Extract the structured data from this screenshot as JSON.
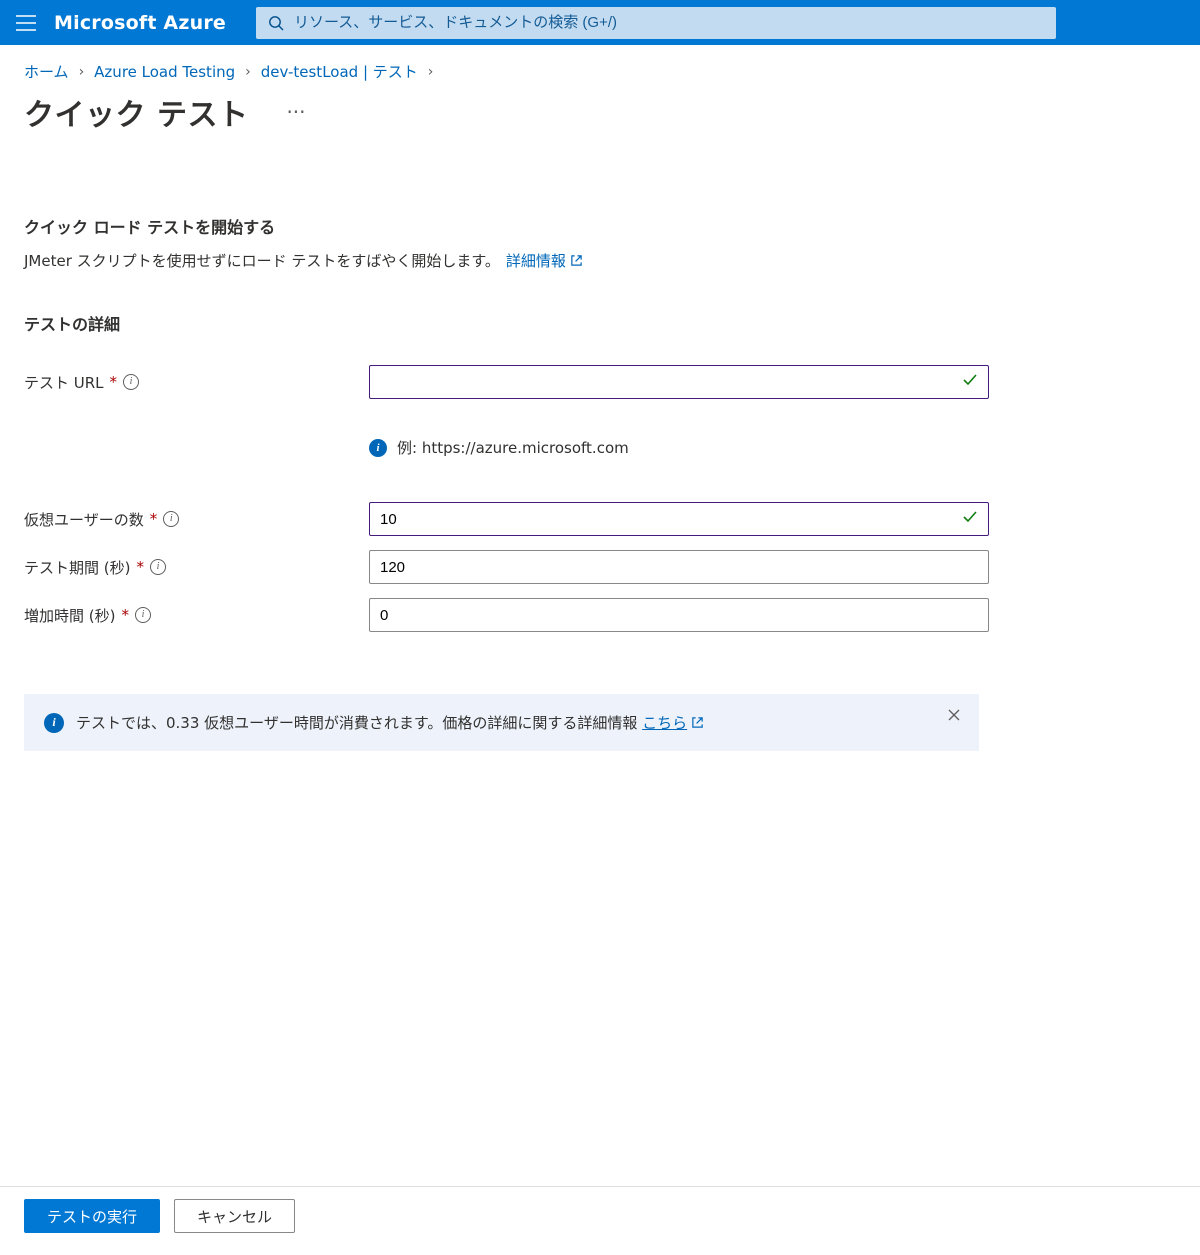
{
  "header": {
    "brand": "Microsoft Azure",
    "search_placeholder": "リソース、サービス、ドキュメントの検索 (G+/)"
  },
  "breadcrumbs": {
    "items": [
      "ホーム",
      "Azure Load Testing",
      "dev-testLoad | テスト"
    ]
  },
  "page": {
    "title": "クイック テスト"
  },
  "intro": {
    "heading": "クイック ロード テストを開始する",
    "text": "JMeter スクリプトを使用せずにロード テストをすばやく開始します。",
    "link_label": "詳細情報"
  },
  "form": {
    "section_heading": "テストの詳細",
    "test_url_label": "テスト URL",
    "test_url_value": "",
    "example_label": "例: https://azure.microsoft.com",
    "virtual_users_label": "仮想ユーザーの数",
    "virtual_users_value": "10",
    "test_duration_label": "テスト期間 (秒)",
    "test_duration_value": "120",
    "ramp_up_label": "増加時間 (秒)",
    "ramp_up_value": "0"
  },
  "banner": {
    "text_prefix": "テストでは、0.33 仮想ユーザー時間が消費されます。価格の詳細に関する詳細情報 ",
    "link_label": "こちら"
  },
  "footer": {
    "run_label": "テストの実行",
    "cancel_label": "キャンセル"
  }
}
